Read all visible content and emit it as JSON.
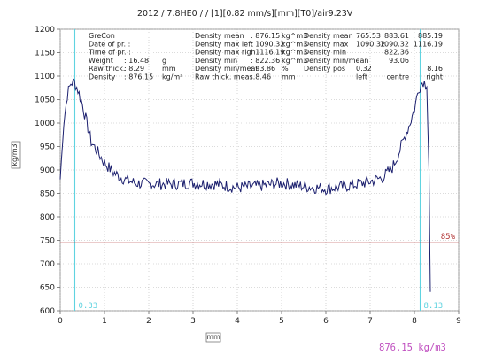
{
  "chart_data": {
    "type": "line",
    "title": "2012 / 7.8HE0 /  / [1][0.82 mm/s][mm][T0]/air9.23V",
    "xlabel": "mm",
    "ylabel": "kg/m3",
    "xlim": [
      0,
      9
    ],
    "ylim": [
      600,
      1200
    ],
    "x_ticks": [
      0,
      1,
      2,
      3,
      4,
      5,
      6,
      7,
      8,
      9
    ],
    "y_ticks": [
      600,
      650,
      700,
      750,
      800,
      850,
      900,
      950,
      1000,
      1050,
      1100,
      1150,
      1200
    ],
    "grid": true,
    "series": [
      {
        "color": "#1b1f6e",
        "x": [
          0.0,
          0.08,
          0.16,
          0.24,
          0.32,
          0.4,
          0.5,
          0.6,
          0.7,
          0.8,
          0.9,
          1.0,
          1.1,
          1.2,
          1.35,
          1.5,
          1.7,
          2.0,
          2.5,
          3.0,
          3.5,
          4.0,
          4.5,
          5.0,
          5.5,
          6.0,
          6.5,
          7.0,
          7.3,
          7.5,
          7.6,
          7.7,
          7.8,
          7.9,
          8.0,
          8.1,
          8.2,
          8.28,
          8.33,
          8.36
        ],
        "y": [
          880,
          1000,
          1060,
          1085,
          1088,
          1070,
          1040,
          1000,
          960,
          945,
          930,
          915,
          905,
          895,
          885,
          878,
          872,
          870,
          870,
          872,
          870,
          862,
          866,
          872,
          865,
          860,
          866,
          875,
          885,
          905,
          925,
          950,
          975,
          1000,
          1030,
          1075,
          1090,
          1080,
          900,
          640
        ]
      }
    ],
    "reference_lines": [
      {
        "axis": "x",
        "value": 0.33,
        "label": "0.33",
        "color": "#5fd3e0"
      },
      {
        "axis": "x",
        "value": 8.13,
        "label": "8.13",
        "color": "#5fd3e0"
      },
      {
        "axis": "y",
        "value": 745,
        "label": "85%",
        "color": "#b03030"
      }
    ],
    "footer_value": "876.15 kg/m3"
  },
  "info": {
    "col1": [
      {
        "label": "GreCon",
        "value": "",
        "unit": ""
      },
      {
        "label": "Date of pr. :",
        "value": "",
        "unit": ""
      },
      {
        "label": "Time of pr. :",
        "value": "",
        "unit": ""
      },
      {
        "label": "Weight",
        "value": ": 16.48",
        "unit": "g"
      },
      {
        "label": "Raw thick.",
        "value": ": 8.29",
        "unit": "mm"
      },
      {
        "label": "Density",
        "value": ": 876.15",
        "unit": "kg/m³"
      }
    ],
    "col2": [
      {
        "label": "Density mean",
        "value": ": 876.15",
        "unit": "kg^m3"
      },
      {
        "label": "Density max left",
        "value": ": 1090.32",
        "unit": "kg^m3"
      },
      {
        "label": "Density max righ",
        "value": ": 1116.19",
        "unit": "kg^m3"
      },
      {
        "label": "Density min",
        "value": ": 822.36",
        "unit": "kg^m3"
      },
      {
        "label": "Density min/mean",
        "value": ": 93.86",
        "unit": "%"
      },
      {
        "label": "Raw thick. meas.",
        "value": ": 8.46",
        "unit": "mm"
      }
    ],
    "col3": [
      {
        "label": "Density mean",
        "v1": "765.53",
        "v2": "883.61",
        "v3": "885.19"
      },
      {
        "label": "Density max",
        "v1": "1090.32",
        "v2": "1090.32",
        "v3": "1116.19"
      },
      {
        "label": "Density min",
        "v1": "",
        "v2": "822.36",
        "v3": ""
      },
      {
        "label": "Density min/mean",
        "v1": "",
        "v2": "93.06",
        "v3": ""
      },
      {
        "label": "Density pos",
        "v1": "0.32",
        "v2": "",
        "v3": "8.16"
      },
      {
        "label": "",
        "v1": "left",
        "v2": "centre",
        "v3": "right"
      }
    ]
  }
}
